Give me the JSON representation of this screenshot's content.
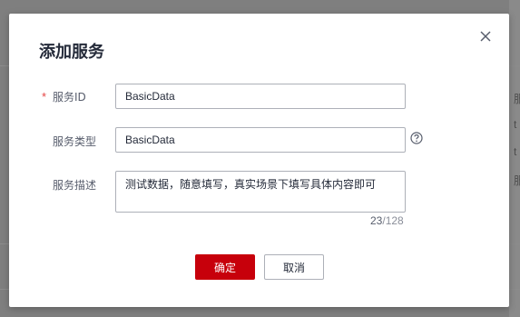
{
  "dialog": {
    "title": "添加服务",
    "close_icon": "close-icon"
  },
  "form": {
    "service_id": {
      "label": "服务ID",
      "required": "*",
      "value": "BasicData"
    },
    "service_type": {
      "label": "服务类型",
      "value": "BasicData",
      "help_icon": "question-circle-icon"
    },
    "service_desc": {
      "label": "服务描述",
      "value": "测试数据，随意填写，真实场景下填写具体内容即可",
      "count": "23",
      "max": "/128"
    }
  },
  "footer": {
    "confirm_label": "确定",
    "cancel_label": "取消"
  },
  "background": {
    "chars": [
      "服",
      "t",
      "t",
      "服"
    ]
  },
  "colors": {
    "primary": "#c7000b",
    "required": "#e54545",
    "text": "#252b3a",
    "label": "#575d6c"
  }
}
